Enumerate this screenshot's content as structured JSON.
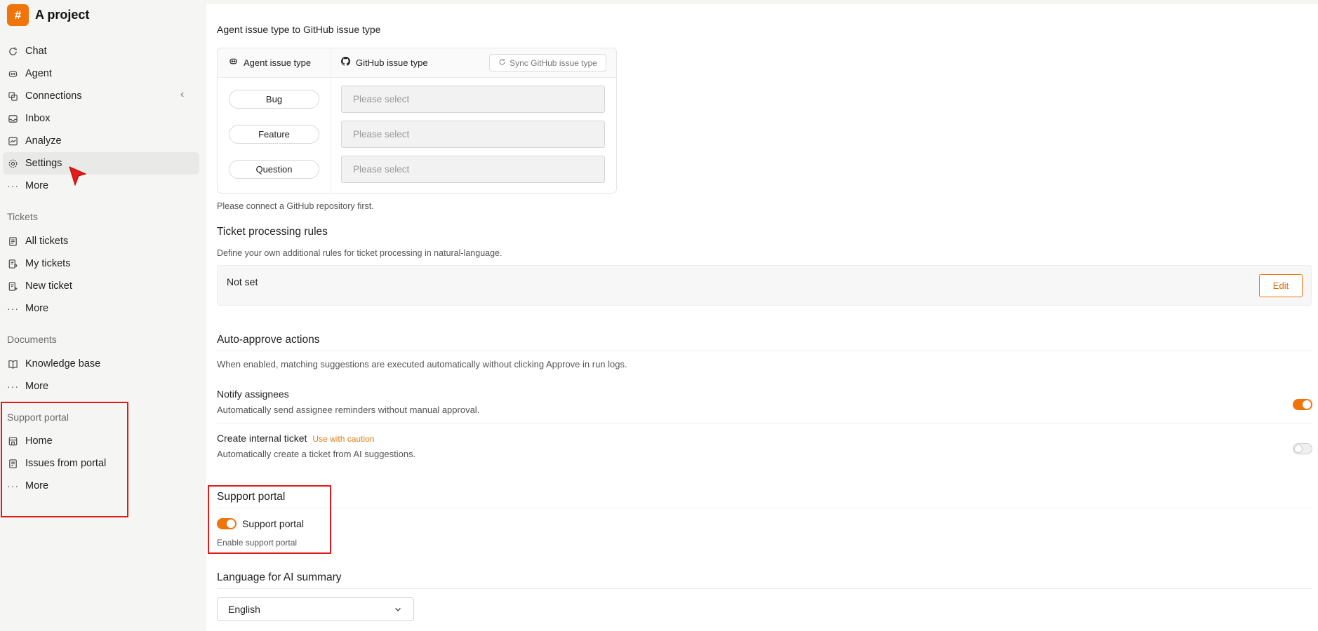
{
  "brand": {
    "name": "A project",
    "logo_glyph": "#"
  },
  "sidebar": {
    "main_items": [
      {
        "label": "Chat",
        "icon": "chat-icon"
      },
      {
        "label": "Agent",
        "icon": "agent-icon"
      },
      {
        "label": "Connections",
        "icon": "connections-icon"
      },
      {
        "label": "Inbox",
        "icon": "inbox-icon"
      },
      {
        "label": "Analyze",
        "icon": "analyze-icon"
      },
      {
        "label": "Settings",
        "icon": "gear-icon"
      },
      {
        "label": "More",
        "icon": "more-icon"
      }
    ],
    "tickets": {
      "title": "Tickets",
      "items": [
        {
          "label": "All tickets"
        },
        {
          "label": "My tickets"
        },
        {
          "label": "New ticket"
        },
        {
          "label": "More"
        }
      ]
    },
    "documents": {
      "title": "Documents",
      "items": [
        {
          "label": "Knowledge base"
        },
        {
          "label": "More"
        }
      ]
    },
    "support_portal": {
      "title": "Support portal",
      "items": [
        {
          "label": "Home"
        },
        {
          "label": "Issues from portal"
        },
        {
          "label": "More"
        }
      ]
    }
  },
  "main": {
    "issue_mapping": {
      "title": "Agent issue type to GitHub issue type",
      "col_agent": "Agent issue type",
      "col_github": "GitHub issue type",
      "sync_label": "Sync GitHub issue type",
      "rows": [
        {
          "type": "Bug",
          "placeholder": "Please select"
        },
        {
          "type": "Feature",
          "placeholder": "Please select"
        },
        {
          "type": "Question",
          "placeholder": "Please select"
        }
      ],
      "note": "Please connect a GitHub repository first."
    },
    "processing_rules": {
      "title": "Ticket processing rules",
      "description": "Define your own additional rules for ticket processing in natural-language.",
      "value": "Not set",
      "edit_label": "Edit"
    },
    "auto_approve": {
      "title": "Auto-approve actions",
      "description": "When enabled, matching suggestions are executed automatically without clicking Approve in run logs.",
      "notify": {
        "label": "Notify assignees",
        "description": "Automatically send assignee reminders without manual approval.",
        "enabled": true
      },
      "internal_ticket": {
        "label": "Create internal ticket",
        "caution": "Use with caution",
        "description": "Automatically create a ticket from AI suggestions.",
        "enabled": false
      }
    },
    "support_portal": {
      "title": "Support portal",
      "toggle_label": "Support portal",
      "description": "Enable support portal",
      "enabled": true
    },
    "language": {
      "title": "Language for AI summary",
      "selected": "English"
    }
  },
  "colors": {
    "accent": "#f0740a",
    "highlight": "#e01919"
  }
}
